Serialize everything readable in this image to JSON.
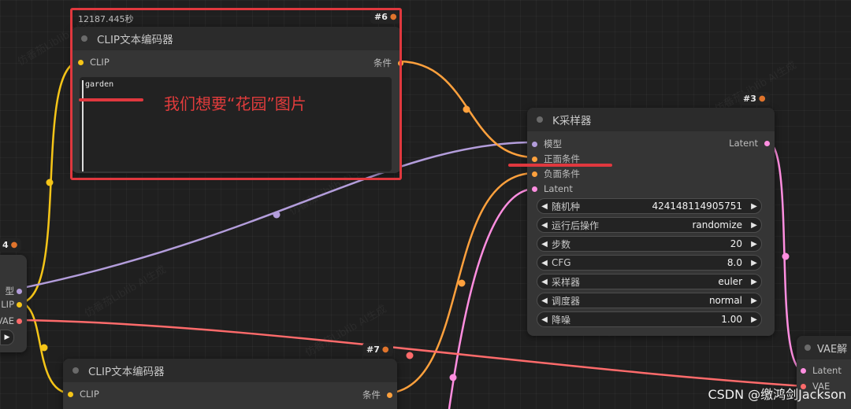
{
  "colors": {
    "clip": "#f5c518",
    "model": "#b39ddb",
    "conditioning": "#ffa13d",
    "latent": "#ff8ee0",
    "vae": "#ff6b6b",
    "annotation": "#e0383e"
  },
  "watermark": "仿番茄Liblib AI生成",
  "execution_time": "12187.445秒",
  "clip_node_top": {
    "id": "#6",
    "title": "CLIP文本编码器",
    "input_clip": "CLIP",
    "output_cond": "条件",
    "text_value": "garden",
    "icon": "fox-icon"
  },
  "annotation_text": "我们想要“花园”图片",
  "ksampler": {
    "id": "#3",
    "title": "K采样器",
    "inputs": [
      "模型",
      "正面条件",
      "负面条件",
      "Latent"
    ],
    "output": "Latent",
    "widgets": [
      {
        "label": "随机种",
        "value": "424148114905751"
      },
      {
        "label": "运行后操作",
        "value": "randomize"
      },
      {
        "label": "步数",
        "value": "20"
      },
      {
        "label": "CFG",
        "value": "8.0"
      },
      {
        "label": "采样器",
        "value": "euler"
      },
      {
        "label": "调度器",
        "value": "normal"
      },
      {
        "label": "降噪",
        "value": "1.00"
      }
    ]
  },
  "checkpoint_node": {
    "id_suffix": "4",
    "outputs": [
      "型",
      "LIP",
      "VAE"
    ]
  },
  "clip_node_bottom": {
    "id": "#7",
    "title": "CLIP文本编码器",
    "input_clip": "CLIP",
    "output_cond": "条件"
  },
  "vae_decode": {
    "title": "VAE解",
    "inputs": [
      "Latent",
      "VAE"
    ]
  },
  "footer_watermark": "CSDN @缴鸿剑Jackson"
}
